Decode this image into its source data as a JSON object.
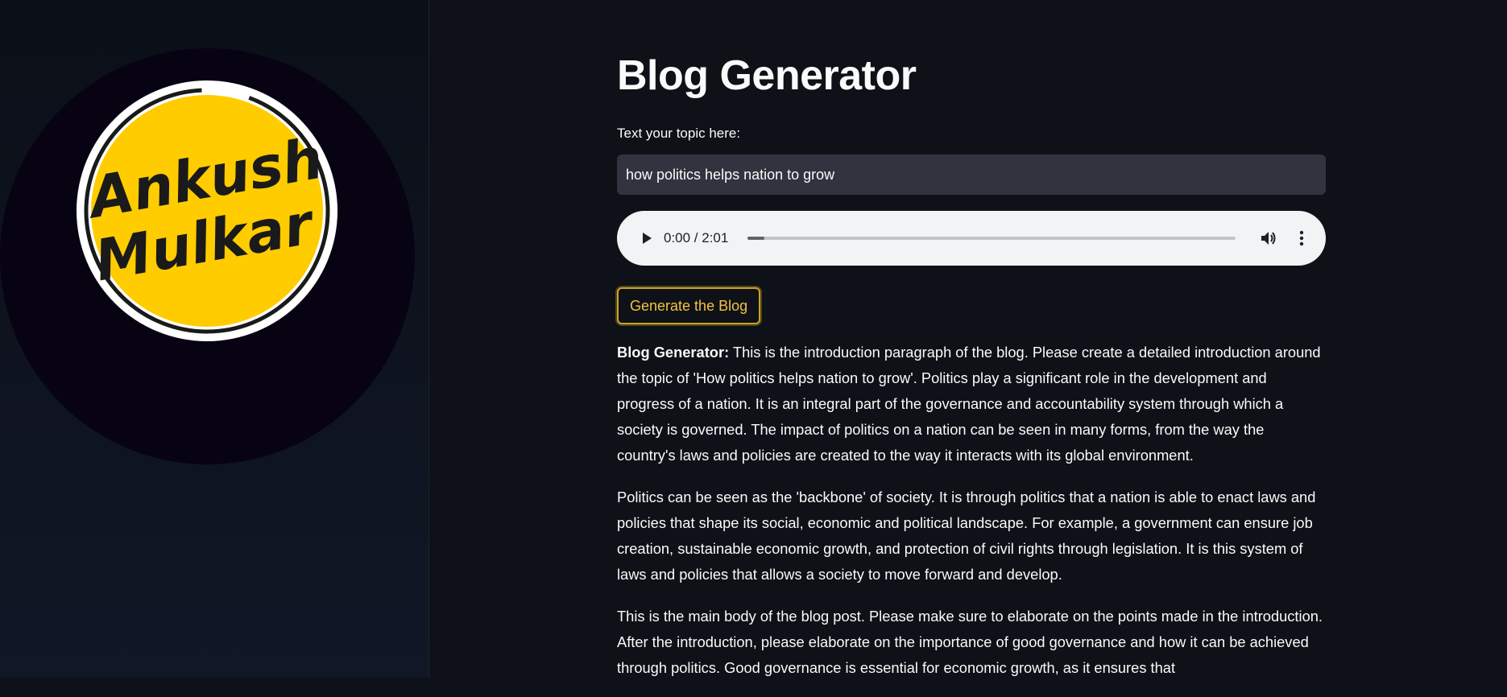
{
  "sidebar": {
    "logo_text": "Ankush Mulkar"
  },
  "main": {
    "title": "Blog Generator",
    "input_label": "Text your topic here:",
    "input_value": "how politics helps nation to grow",
    "audio": {
      "time_display": "0:00 / 2:01",
      "progress": 0.035
    },
    "generate_button_label": "Generate the Blog",
    "blog": {
      "prefix": "Blog Generator:",
      "paragraph_1": " This is the introduction paragraph of the blog. Please create a detailed introduction around the topic of 'How politics helps nation to grow'. Politics play a significant role in the development and progress of a nation. It is an integral part of the governance and accountability system through which a society is governed. The impact of politics on a nation can be seen in many forms, from the way the country's laws and policies are created to the way it interacts with its global environment.",
      "paragraph_2": "Politics can be seen as the 'backbone' of society. It is through politics that a nation is able to enact laws and policies that shape its social, economic and political landscape. For example, a government can ensure job creation, sustainable economic growth, and protection of civil rights through legislation. It is this system of laws and policies that allows a society to move forward and develop.",
      "paragraph_3": "This is the main body of the blog post. Please make sure to elaborate on the points made in the introduction. After the introduction, please elaborate on the importance of good governance and how it can be achieved through politics. Good governance is essential for economic growth, as it ensures that"
    }
  },
  "colors": {
    "background": "#0e1117",
    "logo_yellow": "#ffcc00",
    "button_accent": "#f5c242",
    "input_bg": "#31333f"
  }
}
